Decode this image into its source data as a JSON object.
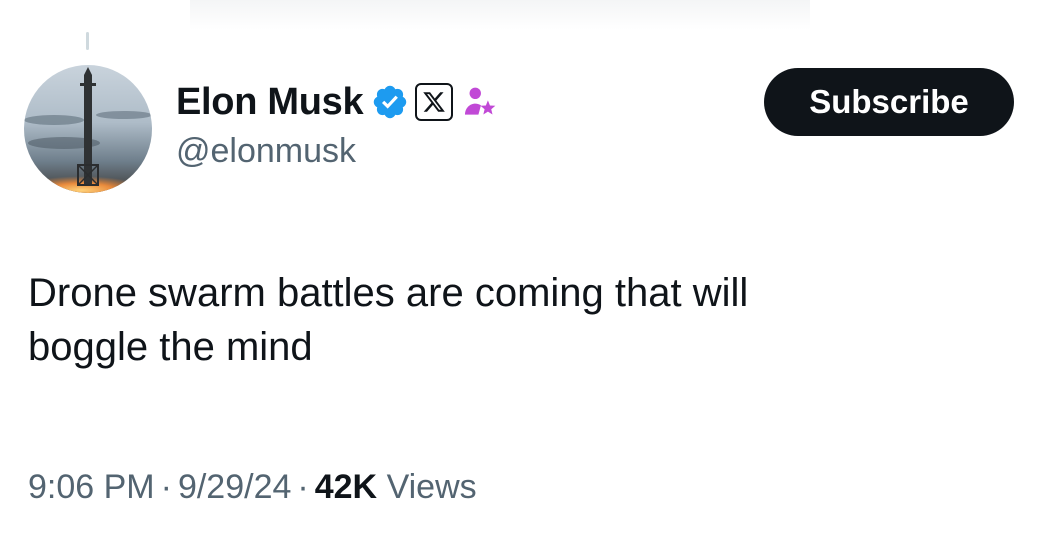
{
  "tweet": {
    "author": {
      "display_name": "Elon Musk",
      "handle": "@elonmusk",
      "avatar_icon": "starship-avatar",
      "verified_badge_icon": "verified-badge-icon",
      "affiliation_icon": "x-affiliation-icon",
      "extra_icon": "person-star-icon"
    },
    "subscribe_label": "Subscribe",
    "text_lines": [
      "Drone swarm battles are coming that will",
      "boggle the mind"
    ],
    "meta": {
      "time": "9:06 PM",
      "separator": "·",
      "date": "9/29/24",
      "views_count": "42K",
      "views_label": "Views"
    }
  },
  "colors": {
    "text": "#0f1419",
    "secondary": "#536471",
    "verified": "#1d9bf0",
    "person_star": "#c149d6",
    "button": "#0f1419"
  }
}
